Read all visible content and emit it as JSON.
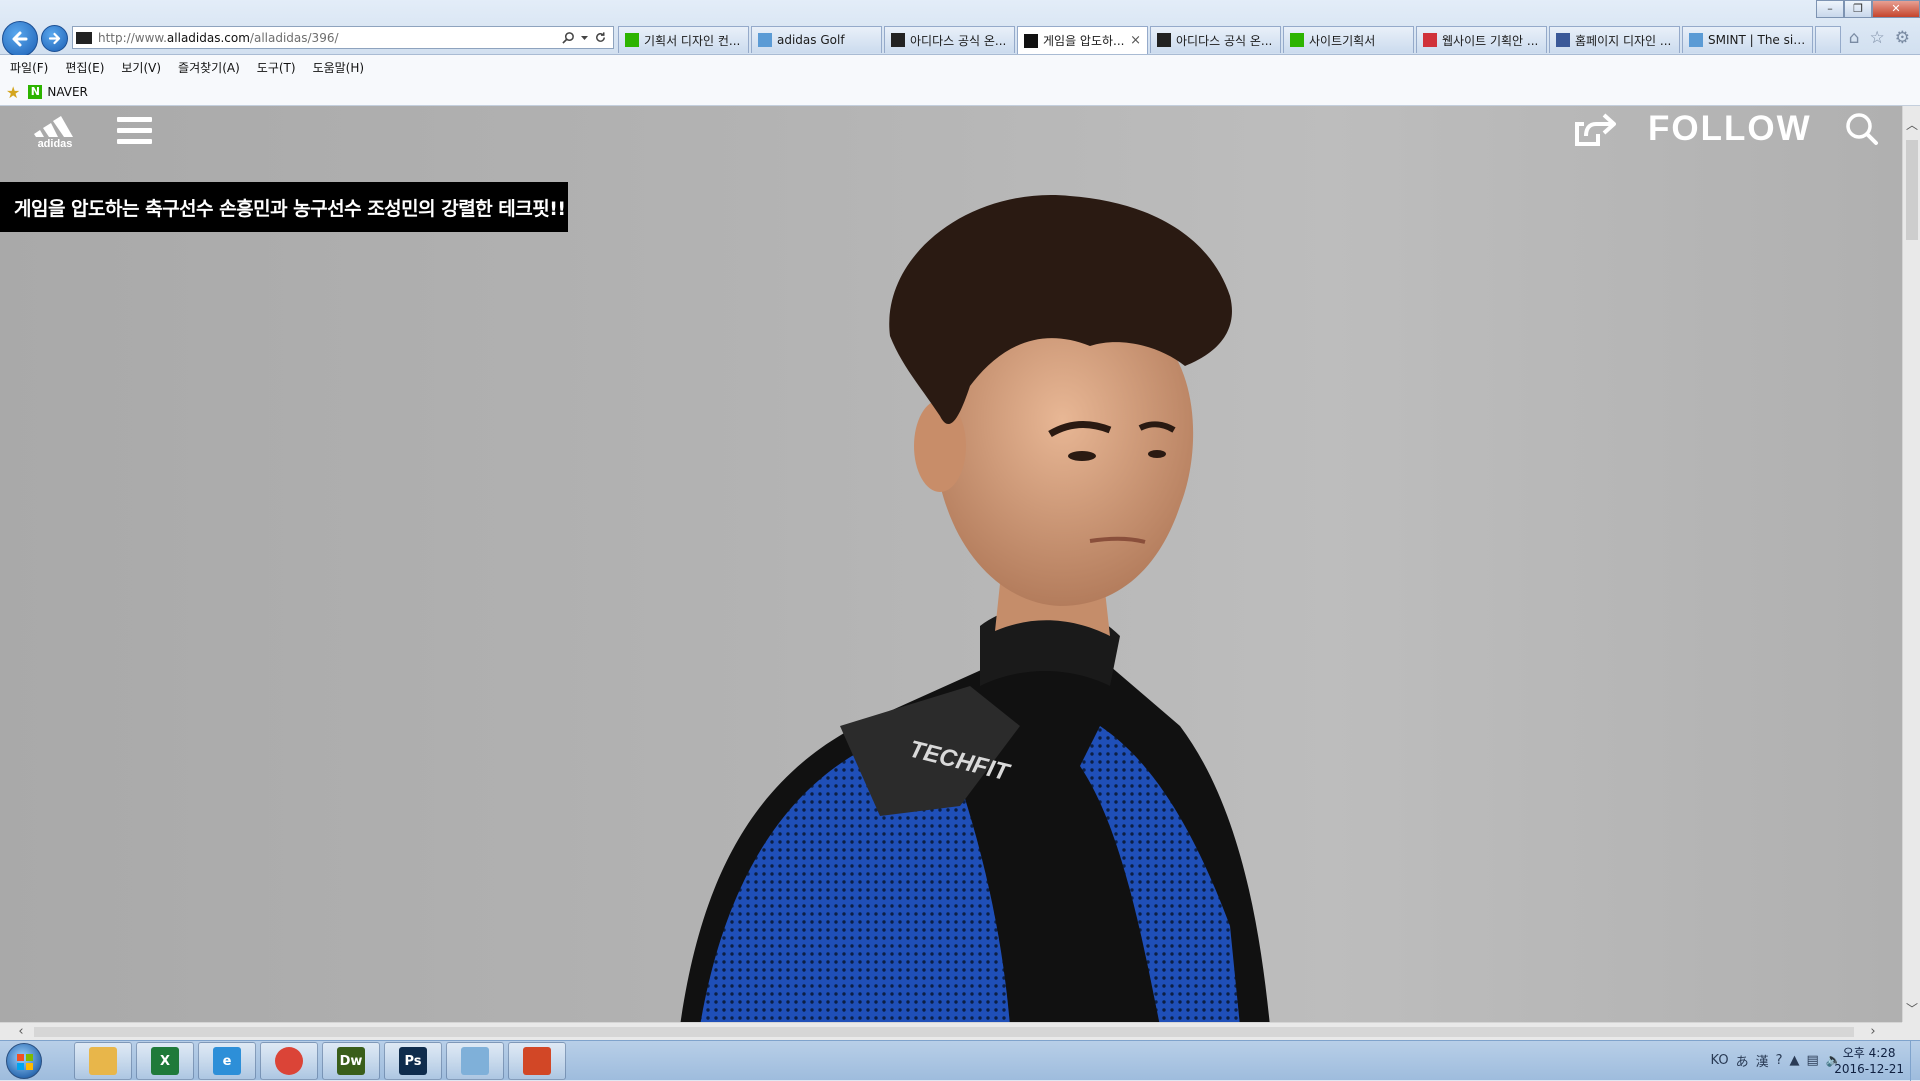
{
  "browser": {
    "address": {
      "prefix": "http://www.",
      "host": "alladidas.com",
      "path": "/alladidas/396/"
    },
    "tabs": [
      {
        "label": "기획서 디자인 컨...",
        "icon": "naver-icon",
        "color": "#2db400",
        "active": false
      },
      {
        "label": "adidas Golf",
        "icon": "ie-page-icon",
        "color": "#5b9bd5",
        "active": false
      },
      {
        "label": "아디다스 공식 온...",
        "icon": "adidas-icon",
        "color": "#222222",
        "active": false
      },
      {
        "label": "게임을 압도하...",
        "icon": "alladidas-icon",
        "color": "#111111",
        "active": true
      },
      {
        "label": "아디다스 공식 온...",
        "icon": "adidas-icon",
        "color": "#222222",
        "active": false
      },
      {
        "label": "사이트기획서",
        "icon": "green-doc-icon",
        "color": "#2db400",
        "active": false
      },
      {
        "label": "웹사이트 기획안 ...",
        "icon": "red-icon",
        "color": "#d0323a",
        "active": false
      },
      {
        "label": "홈페이지 디자인 ...",
        "icon": "facebook-icon",
        "color": "#3b5998",
        "active": false
      },
      {
        "label": "SMINT | The sim...",
        "icon": "ie-page-icon",
        "color": "#5b9bd5",
        "active": false
      }
    ],
    "menu": [
      "파일(F)",
      "편집(E)",
      "보기(V)",
      "즐겨찾기(A)",
      "도구(T)",
      "도움말(H)"
    ],
    "favorites": [
      {
        "label": "NAVER"
      }
    ]
  },
  "page": {
    "follow_label": "FOLLOW",
    "headline": "게임을 압도하는 축구선수 손흥민과 농구선수 조성민의 강렬한 테크핏!!",
    "shirt_text": "TECHFIT"
  },
  "taskbar": {
    "apps": [
      {
        "name": "explorer",
        "label": "",
        "color": "#e8b64a"
      },
      {
        "name": "excel",
        "label": "X",
        "color": "#1f7a3a"
      },
      {
        "name": "internet-explorer",
        "label": "e",
        "color": "#2d8fd8"
      },
      {
        "name": "chrome",
        "label": "",
        "color": "#db4437"
      },
      {
        "name": "dreamweaver",
        "label": "Dw",
        "color": "#3a5e1a"
      },
      {
        "name": "photoshop",
        "label": "Ps",
        "color": "#0f2c4d"
      },
      {
        "name": "notepad",
        "label": "",
        "color": "#7fb0d9"
      },
      {
        "name": "powerpoint",
        "label": "",
        "color": "#d24726"
      }
    ],
    "clock_time": "오후 4:28",
    "clock_date": "2016-12-21"
  }
}
